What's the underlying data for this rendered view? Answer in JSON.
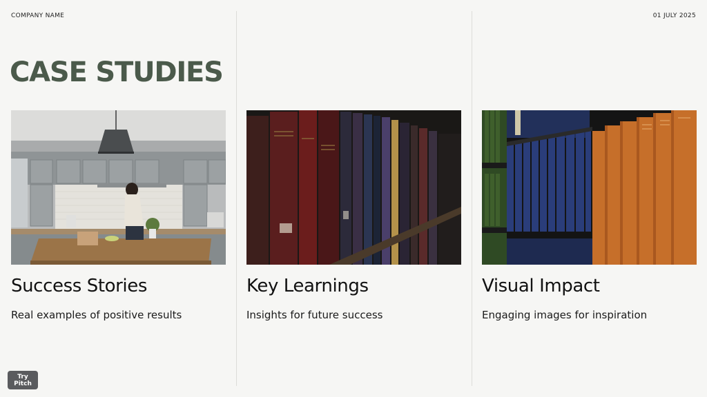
{
  "header": {
    "company": "COMPANY NAME",
    "date": "01 JULY 2025"
  },
  "page": {
    "title": "CASE STUDIES"
  },
  "cards": [
    {
      "title": "Success Stories",
      "description": "Real examples of positive results",
      "image": "kitchen-photo"
    },
    {
      "title": "Key Learnings",
      "description": "Insights for future success",
      "image": "dark-bookshelf-photo"
    },
    {
      "title": "Visual Impact",
      "description": "Engaging images for inspiration",
      "image": "colorful-bookshelf-photo"
    }
  ],
  "footer": {
    "try_button": "Try Pitch"
  },
  "colors": {
    "background": "#f6f6f4",
    "title": "#4b5a4b",
    "button": "#5a5b5e"
  }
}
